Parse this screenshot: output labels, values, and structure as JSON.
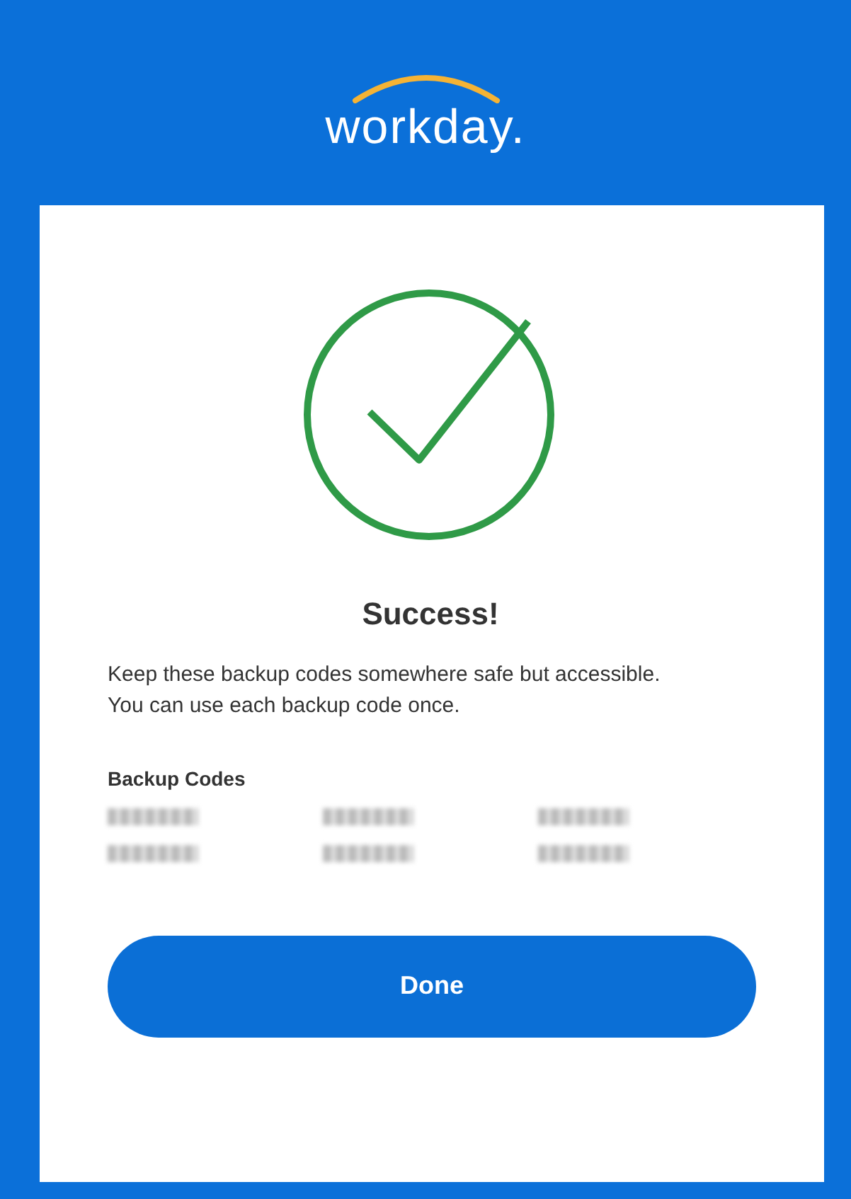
{
  "header": {
    "logo": "workday."
  },
  "card": {
    "status": {
      "kind": "success"
    },
    "title": "Success!",
    "message": "Keep these backup codes somewhere safe but accessible. You can use each backup code once.",
    "codes_label": "Backup Codes",
    "codes": [
      {
        "kind": "redacted"
      },
      {
        "kind": "redacted"
      },
      {
        "kind": "redacted"
      },
      {
        "kind": "redacted"
      },
      {
        "kind": "redacted"
      },
      {
        "kind": "redacted"
      }
    ],
    "button": "Done"
  }
}
